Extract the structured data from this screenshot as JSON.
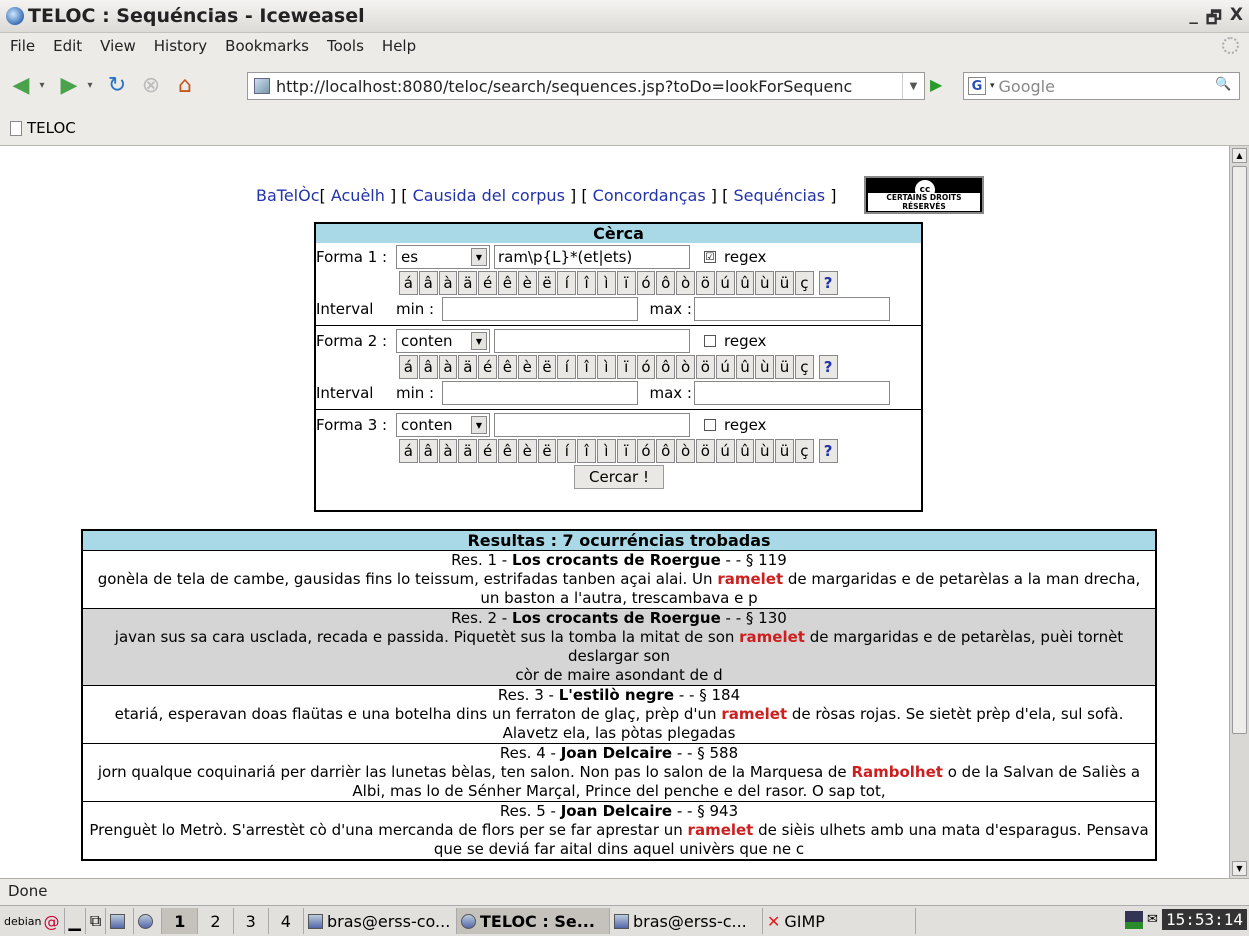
{
  "window": {
    "title": "TELOC : Sequéncias - Iceweasel",
    "controls": [
      "_",
      "🗗",
      "X"
    ]
  },
  "menu": [
    "File",
    "Edit",
    "View",
    "History",
    "Bookmarks",
    "Tools",
    "Help"
  ],
  "toolbar": {
    "url": "http://localhost:8080/teloc/search/sequences.jsp?toDo=lookForSequenc",
    "search_placeholder": "Google",
    "search_engine": "G"
  },
  "bookmarks": {
    "tab": "TELOC"
  },
  "page": {
    "nav": {
      "brand": "BaTelÒc",
      "links": [
        "Acuèlh",
        "Causida del corpus",
        "Concordanças",
        "Sequéncias"
      ]
    },
    "cc_badge": {
      "logo": "cc",
      "text": "CERTAINS DROITS RÉSERVÉS"
    },
    "form": {
      "title": "Cèrca",
      "label1": "Forma 1 :",
      "sel1": "es",
      "val1": "ram\\p{L}*(et|ets)",
      "regex1": "regex",
      "check1": "☑",
      "label2": "Forma 2 :",
      "sel2": "conten",
      "val2": "",
      "regex2": "regex",
      "label3": "Forma 3 :",
      "sel3": "conten",
      "val3": "",
      "regex3": "regex",
      "interval": "Interval",
      "min": "min :",
      "max": "max :",
      "chars": [
        "á",
        "â",
        "à",
        "ä",
        "é",
        "ê",
        "è",
        "ë",
        "í",
        "î",
        "ì",
        "ï",
        "ó",
        "ô",
        "ò",
        "ö",
        "ú",
        "û",
        "ù",
        "ü",
        "ç"
      ],
      "help": "?",
      "submit": "Cercar !"
    },
    "results": {
      "header": "Resultas : 7 ocurréncias trobadas",
      "items": [
        {
          "res": "Res. 1 - ",
          "title": "Los crocants de Roergue",
          "ref": " - - § 119",
          "pre": "gonèla de tela de cambe, gausidas fins lo teissum, estrifadas tanben açai alai. Un ",
          "kw": "ramelet",
          "post": " de margaridas e de petarèlas a la man drecha, un baston a l'autra, trescambava e p"
        },
        {
          "res": "Res. 2 - ",
          "title": "Los crocants de Roergue",
          "ref": " - - § 130",
          "pre": "javan sus sa cara usclada, recada e passida. Piquetèt sus la tomba la mitat de son ",
          "kw": "ramelet",
          "post": " de margaridas e de petarèlas, puèi tornèt deslargar son",
          "extra": "còr de maire asondant de d"
        },
        {
          "res": "Res. 3 - ",
          "title": "L'estilò negre",
          "ref": " - - § 184",
          "pre": "etariá, esperavan doas flaütas e una botelha dins un ferraton de glaç, prèp d'un ",
          "kw": "ramelet",
          "post": " de ròsas rojas. Se sietèt prèp d'ela, sul sofà. Alavetz ela, las pòtas plegadas"
        },
        {
          "res": "Res. 4 - ",
          "title": "Joan Delcaire",
          "ref": " - - § 588",
          "pre": "jorn qualque coquinariá per darrièr las lunetas bèlas, ten salon. Non pas lo salon de la Marquesa de ",
          "kw": "Rambolhet",
          "post": " o de la Salvan de Saliès a Albi, mas lo de Sénher Marçal, Prince del penche e del rasor. O sap tot,"
        },
        {
          "res": "Res. 5 - ",
          "title": "Joan Delcaire",
          "ref": " - - § 943",
          "pre": "Prenguèt lo Metrò. S'arrestèt cò d'una mercanda de flors per se far aprestar un ",
          "kw": "ramelet",
          "post": " de sièis ulhets amb una mata d'esparagus. Pensava que se deviá far aital dins aquel univèrs que ne c"
        }
      ]
    }
  },
  "status": "Done",
  "taskbar": {
    "start": "debian",
    "desktops": [
      "1",
      "2",
      "3",
      "4"
    ],
    "tasks": [
      "bras@erss-co...",
      "TELOC : Se...",
      "bras@erss-c...",
      "GIMP"
    ],
    "clock": "15:53:14"
  }
}
